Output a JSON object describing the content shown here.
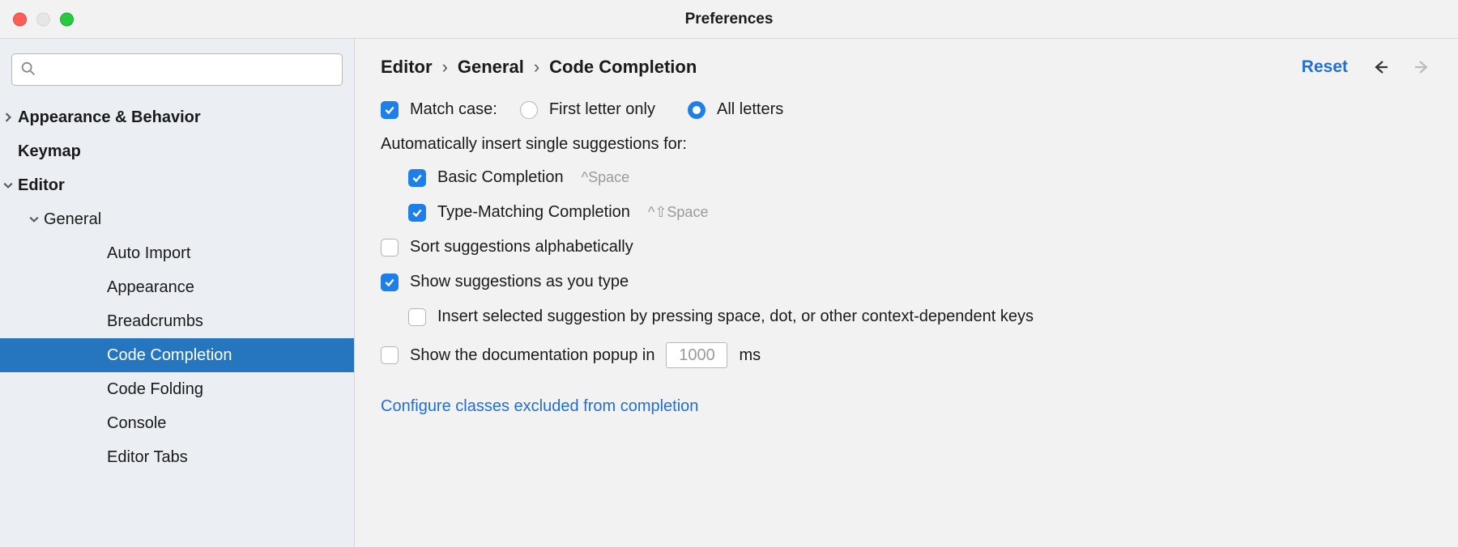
{
  "window": {
    "title": "Preferences"
  },
  "sidebar": {
    "search_placeholder": "",
    "items": [
      {
        "label": "Appearance & Behavior",
        "level": 0,
        "expandable": true,
        "expanded": false,
        "selected": false
      },
      {
        "label": "Keymap",
        "level": 0,
        "expandable": false,
        "expanded": false,
        "selected": false
      },
      {
        "label": "Editor",
        "level": 0,
        "expandable": true,
        "expanded": true,
        "selected": false
      },
      {
        "label": "General",
        "level": 1,
        "expandable": true,
        "expanded": true,
        "selected": false
      },
      {
        "label": "Auto Import",
        "level": 2,
        "expandable": false,
        "expanded": false,
        "selected": false
      },
      {
        "label": "Appearance",
        "level": 2,
        "expandable": false,
        "expanded": false,
        "selected": false
      },
      {
        "label": "Breadcrumbs",
        "level": 2,
        "expandable": false,
        "expanded": false,
        "selected": false
      },
      {
        "label": "Code Completion",
        "level": 2,
        "expandable": false,
        "expanded": false,
        "selected": true
      },
      {
        "label": "Code Folding",
        "level": 2,
        "expandable": false,
        "expanded": false,
        "selected": false
      },
      {
        "label": "Console",
        "level": 2,
        "expandable": false,
        "expanded": false,
        "selected": false
      },
      {
        "label": "Editor Tabs",
        "level": 2,
        "expandable": false,
        "expanded": false,
        "selected": false
      }
    ]
  },
  "header": {
    "breadcrumb": [
      "Editor",
      "General",
      "Code Completion"
    ],
    "reset": "Reset"
  },
  "form": {
    "match_case": {
      "label": "Match case:",
      "checked": true,
      "options": [
        {
          "label": "First letter only",
          "selected": false
        },
        {
          "label": "All letters",
          "selected": true
        }
      ]
    },
    "auto_insert_label": "Automatically insert single suggestions for:",
    "basic_completion": {
      "label": "Basic Completion",
      "hint": "^Space",
      "checked": true
    },
    "type_matching": {
      "label": "Type-Matching Completion",
      "hint": "^⇧Space",
      "checked": true
    },
    "sort_alpha": {
      "label": "Sort suggestions alphabetically",
      "checked": false
    },
    "show_as_type": {
      "label": "Show suggestions as you type",
      "checked": true
    },
    "insert_by_keys": {
      "label": "Insert selected suggestion by pressing space, dot, or other context-dependent keys",
      "checked": false
    },
    "doc_popup": {
      "prefix": "Show the documentation popup in",
      "value": "1000",
      "suffix": "ms",
      "checked": false
    },
    "configure_link": "Configure classes excluded from completion"
  }
}
